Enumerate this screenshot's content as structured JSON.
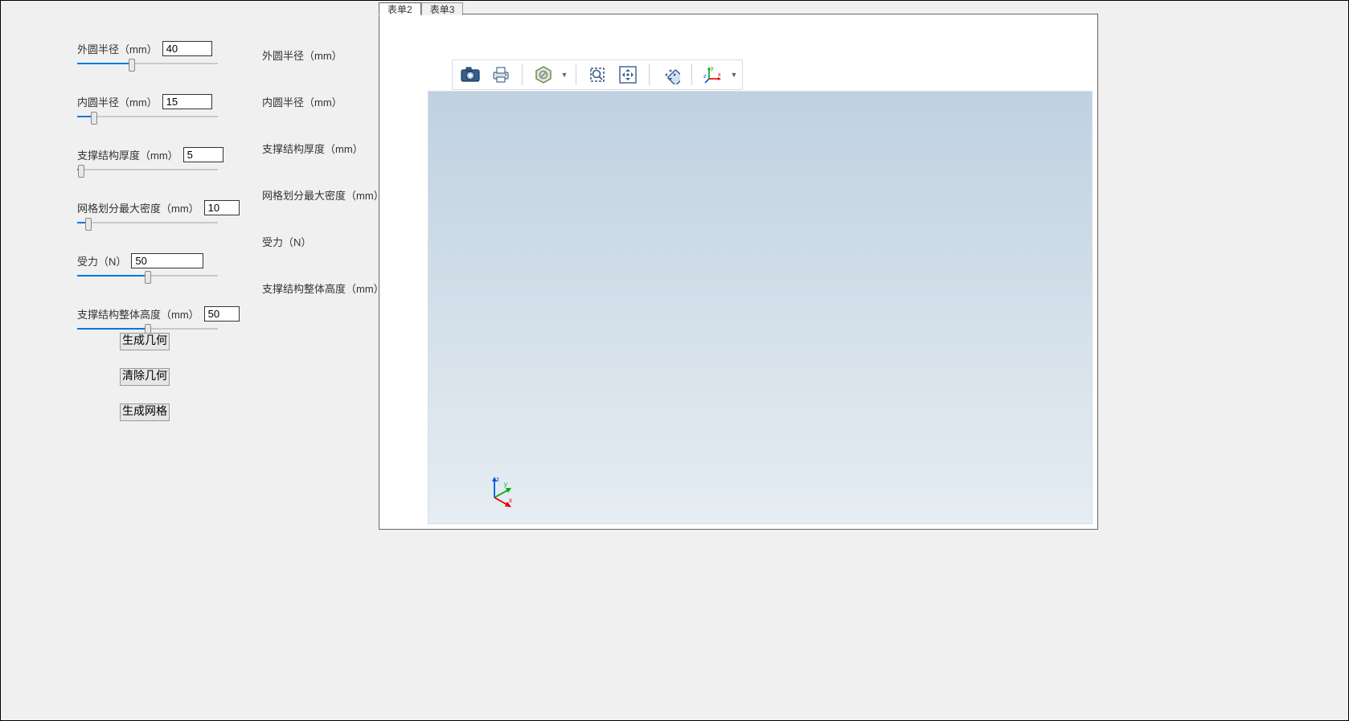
{
  "params": [
    {
      "label": "外圆半径（mm）",
      "value": "40",
      "slider_pct": 39,
      "mid": "外圆半径（mm）"
    },
    {
      "label": "内圆半径（mm）",
      "value": "15",
      "slider_pct": 12,
      "mid": "内圆半径（mm）"
    },
    {
      "label": "支撑结构厚度（mm）",
      "value": "5",
      "slider_pct": 3,
      "mid": "支撑结构厚度（mm）"
    },
    {
      "label": "网格划分最大密度（mm）",
      "value": "10",
      "slider_pct": 8,
      "mid": "网格划分最大密度（mm）"
    },
    {
      "label": "受力（N）",
      "value": "50",
      "slider_pct": 50,
      "mid": "受力（N）"
    },
    {
      "label": "支撑结构整体高度（mm）",
      "value": "50",
      "slider_pct": 50,
      "mid": "支撑结构整体高度（mm）"
    }
  ],
  "buttons": {
    "gen_geometry": "生成几何",
    "clear_geometry": "清除几何",
    "gen_mesh": "生成网格"
  },
  "tabs": [
    {
      "label": "表单2",
      "active": true
    },
    {
      "label": "表单3",
      "active": false
    }
  ],
  "toolbar_icons": [
    "camera",
    "print",
    "|",
    "transparency",
    "caret",
    "|",
    "zoom-box",
    "pan",
    "|",
    "zoom-extents",
    "|",
    "axis-triad",
    "caret"
  ],
  "viewport_axis": {
    "x": "x",
    "y": "y",
    "z": "z"
  }
}
